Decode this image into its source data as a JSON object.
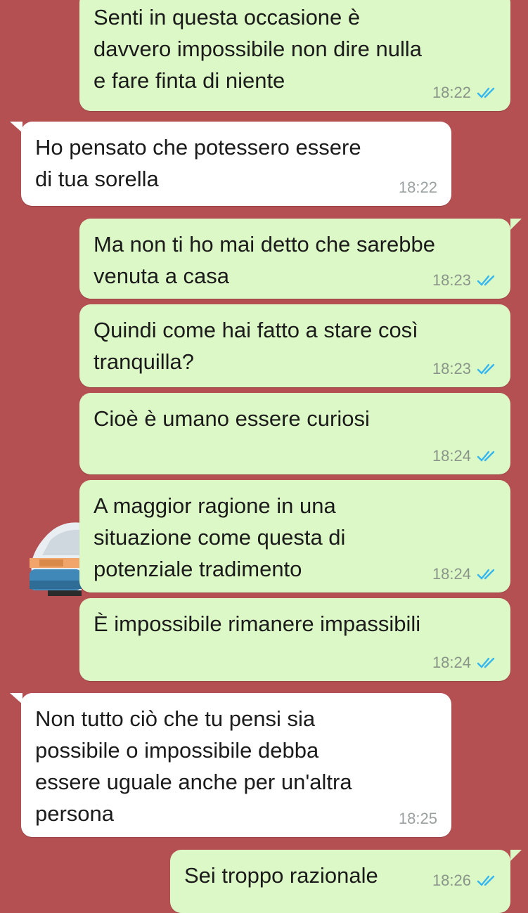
{
  "colors": {
    "background": "#b55052",
    "outgoing_bubble": "#dcf8c6",
    "incoming_bubble": "#ffffff",
    "read_ticks": "#34b7f1",
    "time_text": "#8a958a"
  },
  "messages": [
    {
      "direction": "out",
      "text": "Senti in questa occasione è\ndavvero impossibile non dire nulla\ne fare finta di niente",
      "time": "18:22",
      "status_icon": "double-check-read-icon"
    },
    {
      "direction": "in",
      "text": "Ho pensato che potessero essere\ndi tua sorella",
      "time": "18:22"
    },
    {
      "direction": "out",
      "text": "Ma non ti ho mai detto che sarebbe\nvenuta a casa",
      "time": "18:23",
      "status_icon": "double-check-read-icon"
    },
    {
      "direction": "out",
      "text": "Quindi come hai fatto a stare così\ntranquilla?",
      "time": "18:23",
      "status_icon": "double-check-read-icon"
    },
    {
      "direction": "out",
      "text": "Cioè è umano essere curiosi",
      "time": "18:24",
      "status_icon": "double-check-read-icon"
    },
    {
      "direction": "out",
      "text": "A maggior ragione in una\nsituazione come questa di\npotenziale tradimento",
      "time": "18:24",
      "status_icon": "double-check-read-icon"
    },
    {
      "direction": "out",
      "text": "È impossibile rimanere impassibili",
      "time": "18:24",
      "status_icon": "double-check-read-icon"
    },
    {
      "direction": "in",
      "text": "Non tutto ciò che tu pensi sia\npossibile o impossibile debba\nessere uguale anche per un'altra\npersona",
      "time": "18:25"
    },
    {
      "direction": "out",
      "text": "Sei troppo razionale",
      "time": "18:26",
      "status_icon": "double-check-read-icon"
    }
  ]
}
